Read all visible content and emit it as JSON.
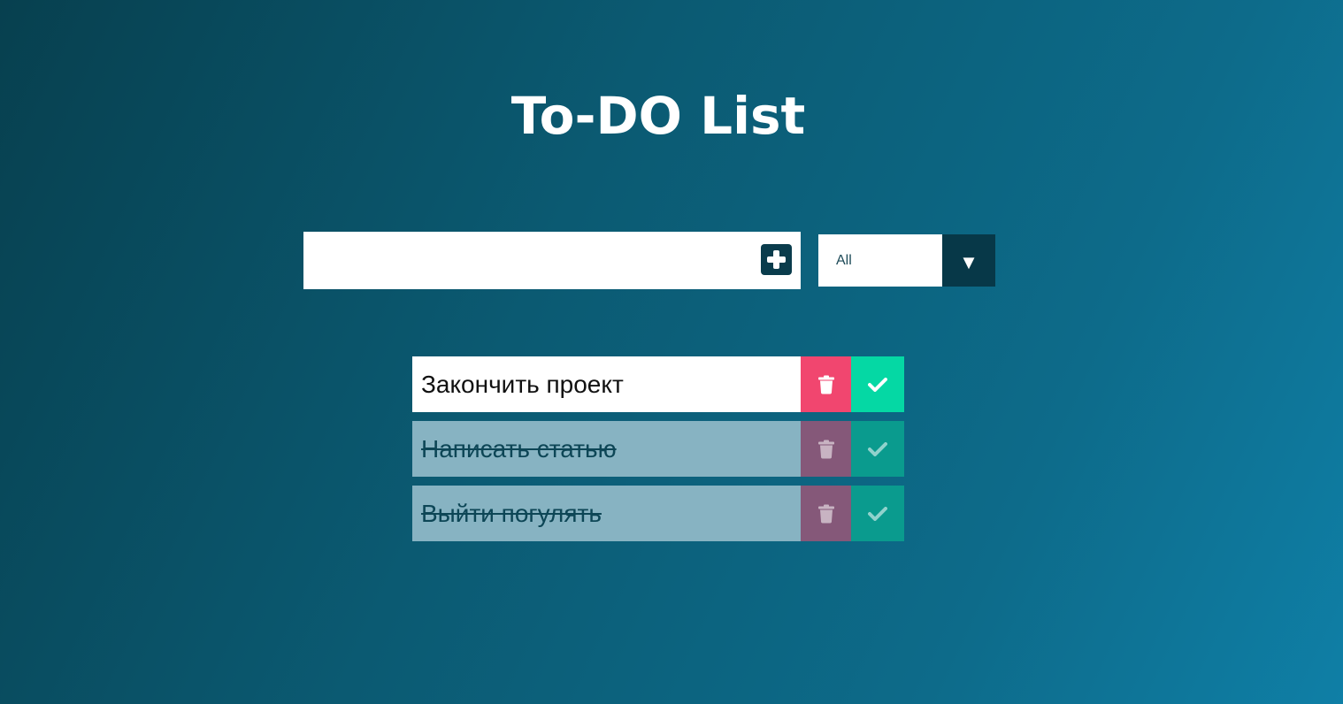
{
  "header": {
    "title": "To-DO List"
  },
  "input": {
    "value": "",
    "placeholder": "",
    "add_icon": "plus-square-icon"
  },
  "filter": {
    "selected": "All",
    "arrow_icon": "caret-down-icon",
    "arrow": "▼"
  },
  "todos": [
    {
      "text": "Закончить проект",
      "completed": false
    },
    {
      "text": "Написать статью",
      "completed": true
    },
    {
      "text": "Выйти погулять",
      "completed": true
    }
  ],
  "icons": {
    "trash": "trash-icon",
    "check": "check-icon"
  },
  "colors": {
    "background_start": "#07404f",
    "background_end": "#0f7fa6",
    "trash_active": "#f1466f",
    "check_active": "#05d8a4",
    "trash_completed": "#855879",
    "check_completed": "#0a9b8e",
    "completed_row": "#87b3c2",
    "dark_accent": "#073848"
  }
}
